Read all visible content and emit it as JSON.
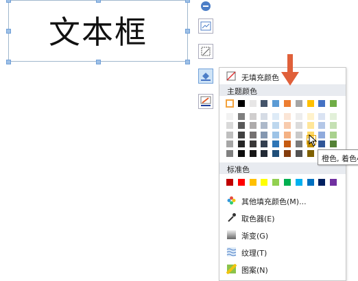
{
  "textbox": {
    "text": "文本框"
  },
  "toolbar": {
    "tools": [
      {
        "name": "collapse-icon"
      },
      {
        "name": "layout-icon"
      },
      {
        "name": "crop-icon"
      },
      {
        "name": "fill-bucket-icon"
      },
      {
        "name": "outline-pen-icon"
      }
    ]
  },
  "fill_menu": {
    "no_fill_label": "无填充颜色",
    "theme_colors_header": "主题颜色",
    "theme_top_row": [
      "#ffffff",
      "#000000",
      "#e7e6e6",
      "#44546a",
      "#5b9bd5",
      "#ed7d31",
      "#a5a5a5",
      "#ffc000",
      "#4472c4",
      "#70ad47"
    ],
    "theme_shades": [
      [
        "#f2f2f2",
        "#7f7f7f",
        "#d0cece",
        "#d6dce5",
        "#deebf7",
        "#fbe5d6",
        "#ededed",
        "#fff2cc",
        "#dae3f3",
        "#e2f0d9"
      ],
      [
        "#d9d9d9",
        "#595959",
        "#aeabab",
        "#adb9ca",
        "#bdd7ee",
        "#f8cbad",
        "#dbdbdb",
        "#ffe699",
        "#b4c7e7",
        "#c5e0b4"
      ],
      [
        "#bfbfbf",
        "#404040",
        "#757171",
        "#8497b0",
        "#9dc3e6",
        "#f4b183",
        "#c9c9c9",
        "#ffd966",
        "#8faadc",
        "#a9d18e"
      ],
      [
        "#a6a6a6",
        "#262626",
        "#3a3838",
        "#333f50",
        "#2e75b6",
        "#c55a11",
        "#7b7b7b",
        "#bf9000",
        "#2f5597",
        "#538135"
      ],
      [
        "#808080",
        "#0d0d0d",
        "#171616",
        "#222a35",
        "#1f4e79",
        "#843c0c",
        "#525252",
        "#7f6000",
        "#203864",
        "#385723"
      ]
    ],
    "standard_colors_header": "标准色",
    "standard_colors": [
      "#c00000",
      "#ff0000",
      "#ffc000",
      "#ffff00",
      "#92d050",
      "#00b050",
      "#00b0f0",
      "#0070c0",
      "#002060",
      "#7030a0"
    ],
    "items": [
      {
        "label": "其他填充颜色(M)...",
        "icon": "color-wheel-icon"
      },
      {
        "label": "取色器(E)",
        "icon": "eyedropper-icon"
      },
      {
        "label": "渐变(G)",
        "icon": "gradient-icon"
      },
      {
        "label": "纹理(T)",
        "icon": "texture-icon"
      },
      {
        "label": "图案(N)",
        "icon": "pattern-icon"
      }
    ],
    "tooltip": "橙色, 着色4"
  },
  "colors": {
    "arrow": "#e0603a",
    "selection": "#f3a23c"
  }
}
